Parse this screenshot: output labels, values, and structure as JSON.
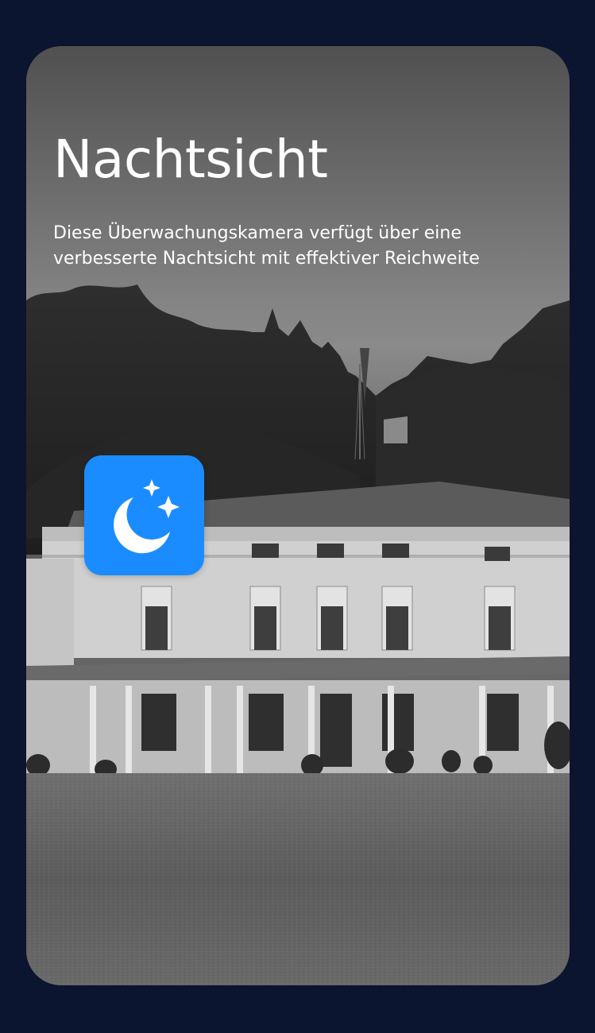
{
  "header": {
    "title": "Nachtsicht",
    "subtitle": "Diese Überwachungskamera verfügt über eine verbesserte Nachtsicht mit effektiver Reichweite"
  },
  "badge": {
    "icon": "moon-stars-icon",
    "color": "#1a8cff"
  },
  "colors": {
    "page_background": "#0b1530",
    "text": "#ffffff"
  }
}
